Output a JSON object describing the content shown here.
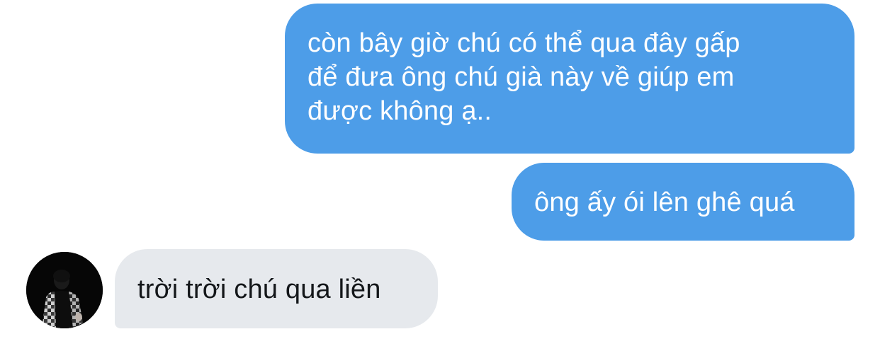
{
  "conversation": {
    "messages": [
      {
        "direction": "sent",
        "text": "còn bây giờ chú có thể qua đây gấp\nđể đưa ông chú già này về giúp em\nđược không ạ.."
      },
      {
        "direction": "sent",
        "text": "ông ấy ói lên ghê quá"
      },
      {
        "direction": "received",
        "text": "trời trời chú qua liền"
      }
    ]
  },
  "colors": {
    "sent_bubble": "#4d9de8",
    "received_bubble": "#e6e9ed",
    "background": "#ffffff"
  },
  "icons": {
    "avatar": "contact-avatar-photo"
  }
}
